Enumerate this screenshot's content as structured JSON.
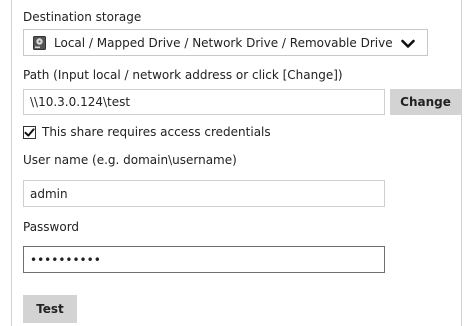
{
  "destination": {
    "label": "Destination storage",
    "selected": "Local / Mapped Drive / Network Drive / Removable Drive"
  },
  "path": {
    "label": "Path (Input local / network address or click [Change])",
    "value": "\\\\10.3.0.124\\test",
    "change_label": "Change"
  },
  "credentials": {
    "checkbox_label": "This share requires access credentials",
    "checked": true
  },
  "username": {
    "label": "User name (e.g. domain\\username)",
    "value": "admin"
  },
  "password": {
    "label": "Password",
    "masked_value": "••••••••••"
  },
  "test_label": "Test",
  "colors": {
    "button_bg": "#d3d3d3",
    "border": "#cfcfcf",
    "focused_border": "#6f6f6f",
    "text": "#222222"
  },
  "icons": {
    "drive": "hard-drive-icon",
    "dropdown": "chevron-down-icon",
    "check": "check-icon"
  }
}
